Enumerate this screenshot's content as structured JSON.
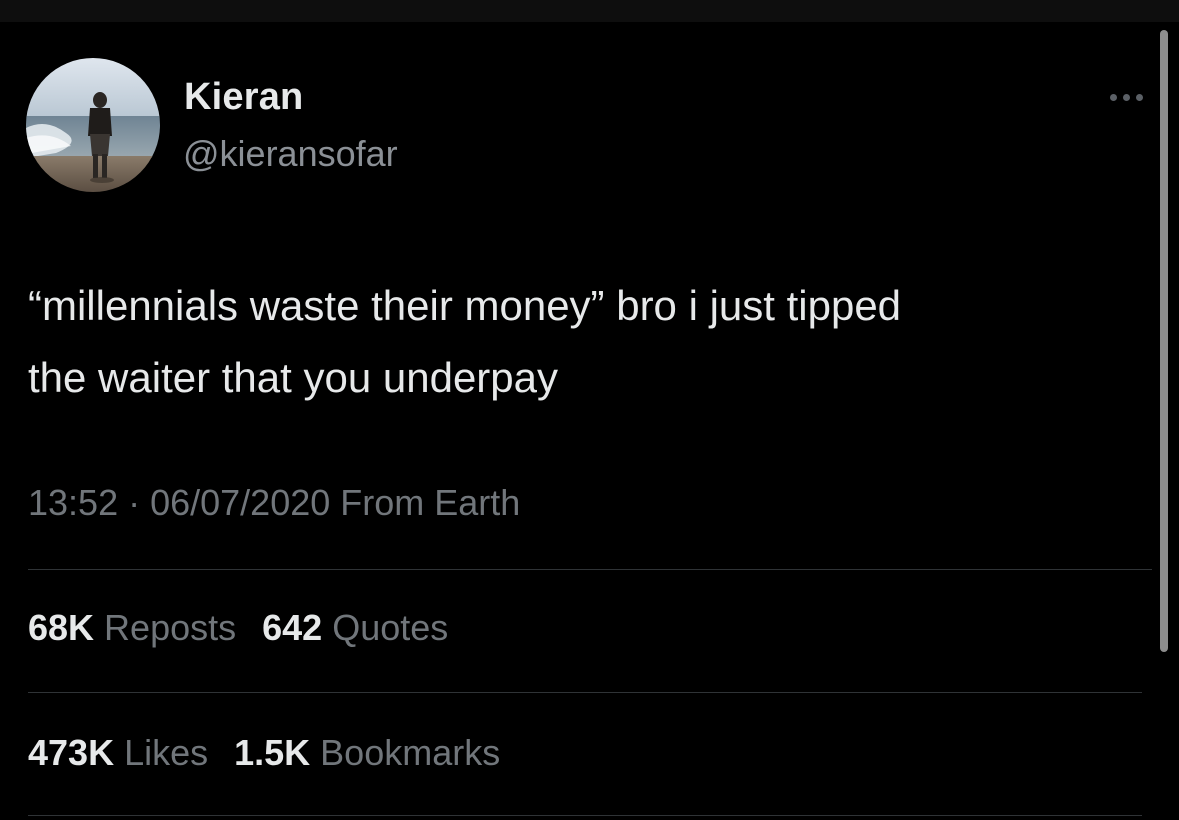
{
  "author": {
    "display_name": "Kieran",
    "handle": "@kieransofar",
    "avatar_icon": "profile-photo"
  },
  "more_icon": "more-horizontal-icon",
  "tweet": {
    "text": "“millennials waste their money” bro i just tipped\nthe waiter that you underpay",
    "meta": "13:52 · 06/07/2020 From Earth"
  },
  "stats_row1": [
    {
      "count": "68K",
      "label": "Reposts"
    },
    {
      "count": "642",
      "label": "Quotes"
    }
  ],
  "stats_row2": [
    {
      "count": "473K",
      "label": "Likes"
    },
    {
      "count": "1.5K",
      "label": "Bookmarks"
    }
  ],
  "colors": {
    "background": "#000000",
    "primary_text": "#e7e9ea",
    "secondary_text": "#71767b",
    "divider": "#2f3336"
  }
}
